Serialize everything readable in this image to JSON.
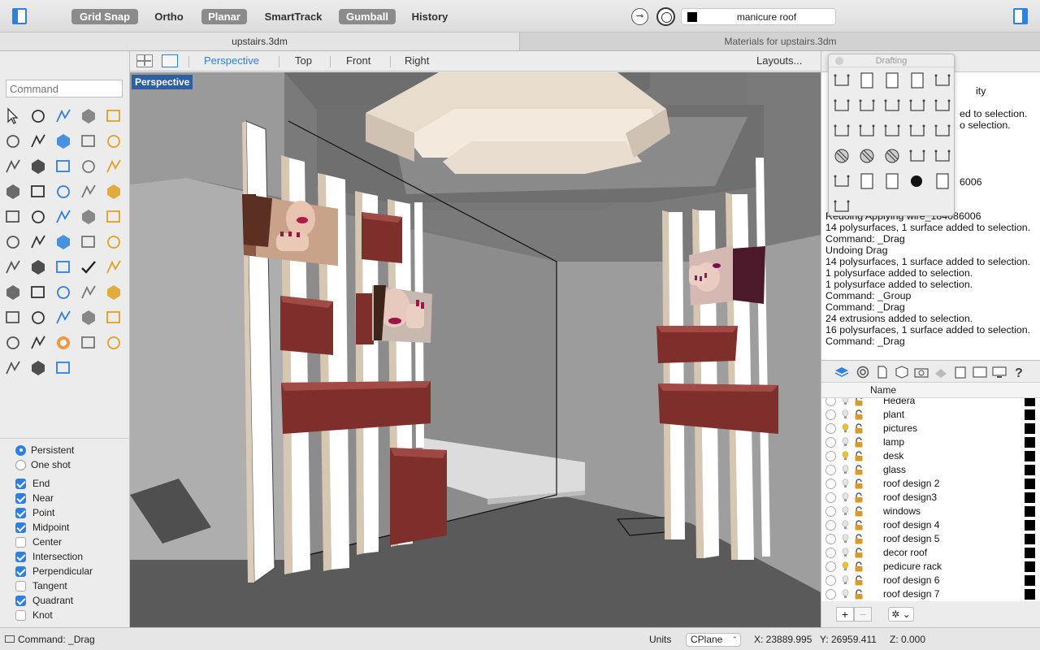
{
  "toolbar": {
    "modes": [
      {
        "label": "Grid Snap",
        "on": true
      },
      {
        "label": "Ortho",
        "on": false
      },
      {
        "label": "Planar",
        "on": true
      },
      {
        "label": "SmartTrack",
        "on": false
      },
      {
        "label": "Gumball",
        "on": true
      },
      {
        "label": "History",
        "on": false
      }
    ],
    "current_layer": "manicure roof"
  },
  "doc_tabs": {
    "main": "upstairs.3dm",
    "materials": "Materials for upstairs.3dm"
  },
  "command_placeholder": "Command",
  "viewport_tabs": {
    "perspective": "Perspective",
    "top": "Top",
    "front": "Front",
    "right": "Right",
    "layouts": "Layouts..."
  },
  "viewport_label": "Perspective",
  "osnap": {
    "mode_persistent": "Persistent",
    "mode_oneshot": "One shot",
    "items": [
      {
        "label": "End",
        "checked": true
      },
      {
        "label": "Near",
        "checked": true
      },
      {
        "label": "Point",
        "checked": true
      },
      {
        "label": "Midpoint",
        "checked": true
      },
      {
        "label": "Center",
        "checked": false
      },
      {
        "label": "Intersection",
        "checked": true
      },
      {
        "label": "Perpendicular",
        "checked": true
      },
      {
        "label": "Tangent",
        "checked": false
      },
      {
        "label": "Quadrant",
        "checked": true
      },
      {
        "label": "Knot",
        "checked": false
      }
    ]
  },
  "drafting": {
    "title": "Drafting"
  },
  "history": {
    "partial": [
      "ity",
      "ed to selection.",
      "o selection.",
      "6006"
    ],
    "lines": [
      "Redoing Applying wire_184086006",
      "14 polysurfaces, 1 surface added to selection.",
      "Command: _Drag",
      "Undoing Drag",
      "14 polysurfaces, 1 surface added to selection.",
      "1 polysurface added to selection.",
      "1 polysurface added to selection.",
      "Command: _Group",
      "Command: _Drag",
      "24 extrusions added to selection.",
      "16 polysurfaces, 1 surface added to selection.",
      "Command: _Drag"
    ]
  },
  "layers": {
    "header": "Name",
    "rows": [
      {
        "name": "Hedera",
        "bulb": false
      },
      {
        "name": "plant",
        "bulb": false
      },
      {
        "name": "pictures",
        "bulb": true
      },
      {
        "name": "lamp",
        "bulb": false
      },
      {
        "name": "desk",
        "bulb": true
      },
      {
        "name": "glass",
        "bulb": false
      },
      {
        "name": "roof design 2",
        "bulb": false
      },
      {
        "name": "roof design3",
        "bulb": false
      },
      {
        "name": "windows",
        "bulb": false
      },
      {
        "name": "roof design 4",
        "bulb": false
      },
      {
        "name": "roof design 5",
        "bulb": false
      },
      {
        "name": "decor roof",
        "bulb": false
      },
      {
        "name": "pedicure rack",
        "bulb": true
      },
      {
        "name": "roof design 6",
        "bulb": false
      },
      {
        "name": "roof design 7",
        "bulb": false
      }
    ],
    "add_label": "+",
    "remove_label": "−",
    "gear_label": "✲ ⌄"
  },
  "status": {
    "command": "Command: _Drag",
    "units": "Units",
    "cplane": "CPlane",
    "x": "X: 23889.995",
    "y": "Y: 26959.411",
    "z": "Z: 0.000"
  },
  "colors": {
    "accent": "#2d7fe0",
    "viewport_label_bg": "#2e5f9e",
    "shelf": "#7e2f2c",
    "column": "#ffffff"
  }
}
